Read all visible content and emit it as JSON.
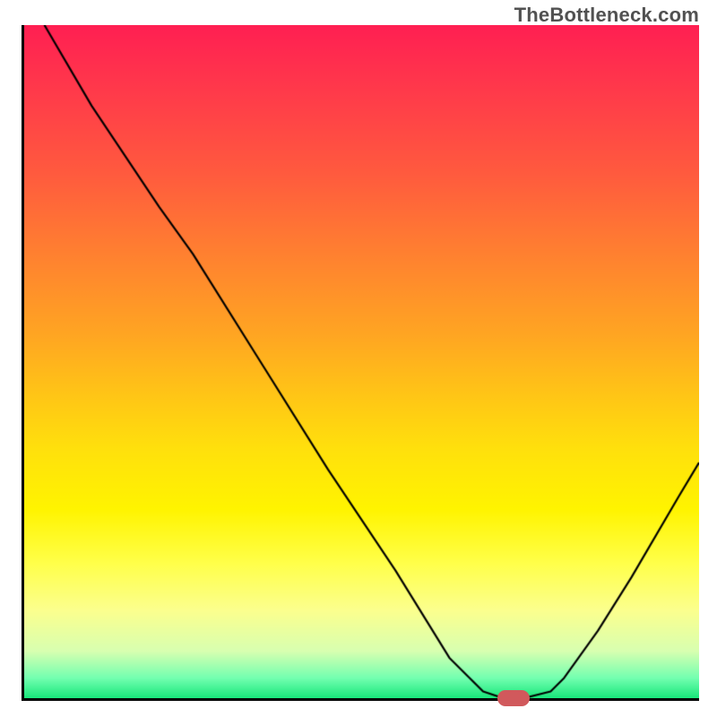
{
  "watermark": "TheBottleneck.com",
  "chart_data": {
    "type": "line",
    "title": "",
    "xlabel": "",
    "ylabel": "",
    "xlim": [
      0,
      100
    ],
    "ylim": [
      0,
      100
    ],
    "series": [
      {
        "name": "curve",
        "x": [
          3,
          10,
          20,
          25,
          35,
          45,
          55,
          63,
          68,
          71,
          74,
          78,
          80,
          85,
          90,
          97,
          100
        ],
        "y": [
          100,
          88,
          73,
          66,
          50,
          34,
          19,
          6,
          1,
          0,
          0,
          1,
          3,
          10,
          18,
          30,
          35
        ]
      }
    ],
    "marker": {
      "x_center": 72.5,
      "y": 0,
      "width_pct": 4.8,
      "color": "#d1595c"
    }
  },
  "gradient_stops": [
    "#ff1f52",
    "#ff3a4a",
    "#ff5a3e",
    "#ff8030",
    "#ffa522",
    "#ffc516",
    "#ffe00c",
    "#fff400",
    "#ffff4a",
    "#fbff8e",
    "#d8ffb0",
    "#73ffb0",
    "#18e67a"
  ]
}
